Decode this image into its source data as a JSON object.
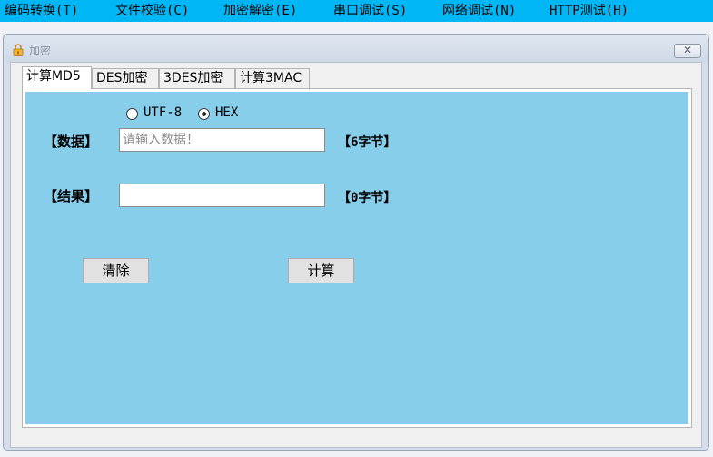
{
  "menu": [
    {
      "label": "编码转换(T)"
    },
    {
      "label": "文件校验(C)"
    },
    {
      "label": "加密解密(E)"
    },
    {
      "label": "串口调试(S)"
    },
    {
      "label": "网络调试(N)"
    },
    {
      "label": "HTTP测试(H)"
    }
  ],
  "colors": {
    "menubar": "#00b7f5",
    "panel": "#87ceeb"
  },
  "window": {
    "title": "加密",
    "icon": "lock-icon",
    "close_glyph": "✕"
  },
  "tabs": [
    {
      "label": "计算MD5",
      "active": true
    },
    {
      "label": "DES加密",
      "active": false
    },
    {
      "label": "3DES加密",
      "active": false
    },
    {
      "label": "计算3MAC",
      "active": false
    }
  ],
  "encoding": {
    "options": [
      {
        "label": "UTF-8",
        "checked": false
      },
      {
        "label": "HEX",
        "checked": true
      }
    ]
  },
  "data_field": {
    "label": "【数据】",
    "value": "",
    "placeholder": "请输入数据！",
    "bytes": "【6字节】"
  },
  "result_field": {
    "label": "【结果】",
    "value": "",
    "bytes": "【0字节】"
  },
  "buttons": {
    "clear": "清除",
    "compute": "计算"
  }
}
